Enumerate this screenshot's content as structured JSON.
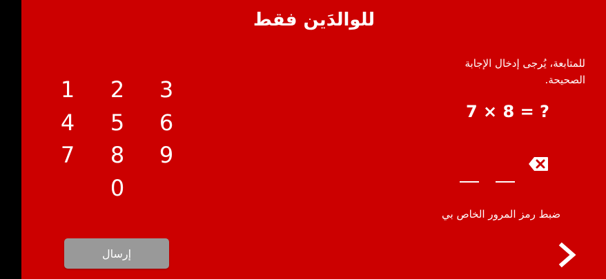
{
  "title": "للوالدَين فقط",
  "instruction": "للمتابعة، يُرجى إدخال الإجابة الصحيحة.",
  "question": "7 × 8 = ?",
  "keypad": {
    "keys": [
      "1",
      "2",
      "3",
      "4",
      "5",
      "6",
      "7",
      "8",
      "9",
      "0"
    ]
  },
  "reset_pin_label": "ضبط رمز المرور الخاص بي",
  "submit_label": "إرسال",
  "colors": {
    "background": "#cc0000",
    "button": "#999999",
    "left_bar": "#000000"
  },
  "icons": {
    "backspace": "backspace-icon",
    "next": "chevron-right-icon"
  }
}
